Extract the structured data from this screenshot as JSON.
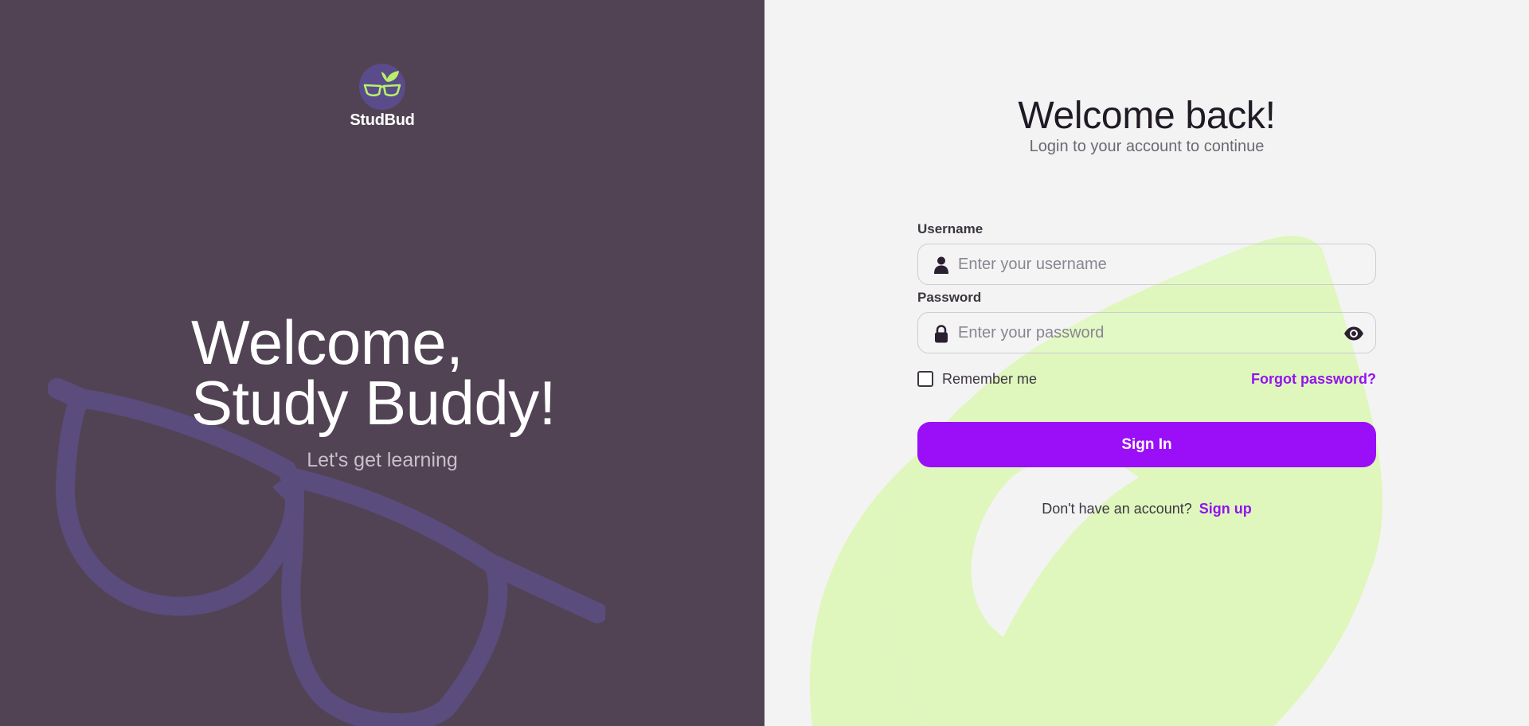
{
  "brand": {
    "name": "StudBud",
    "colors": {
      "panel": "#514354",
      "logo_circle": "#5a4c8a",
      "leaf_green": "#b9f06a"
    }
  },
  "hero": {
    "line1": "Welcome,",
    "line2": "Study Buddy!",
    "tagline": "Let's get learning"
  },
  "login": {
    "title": "Welcome back!",
    "subtitle": "Login to your account to continue",
    "username": {
      "label": "Username",
      "placeholder": "Enter your username",
      "value": "",
      "icon": "user-icon"
    },
    "password": {
      "label": "Password",
      "placeholder": "Enter your password",
      "value": "",
      "icon": "lock-icon",
      "toggle_icon": "eye-icon"
    },
    "remember_label": "Remember me",
    "remember_checked": false,
    "forgot_label": "Forgot password?",
    "signin_label": "Sign In",
    "signup_prompt": "Don't have an account?",
    "signup_label": "Sign up",
    "colors": {
      "accent": "#9a0ff7",
      "link": "#9412f0",
      "leaf_bg": "#dff7bd"
    }
  }
}
